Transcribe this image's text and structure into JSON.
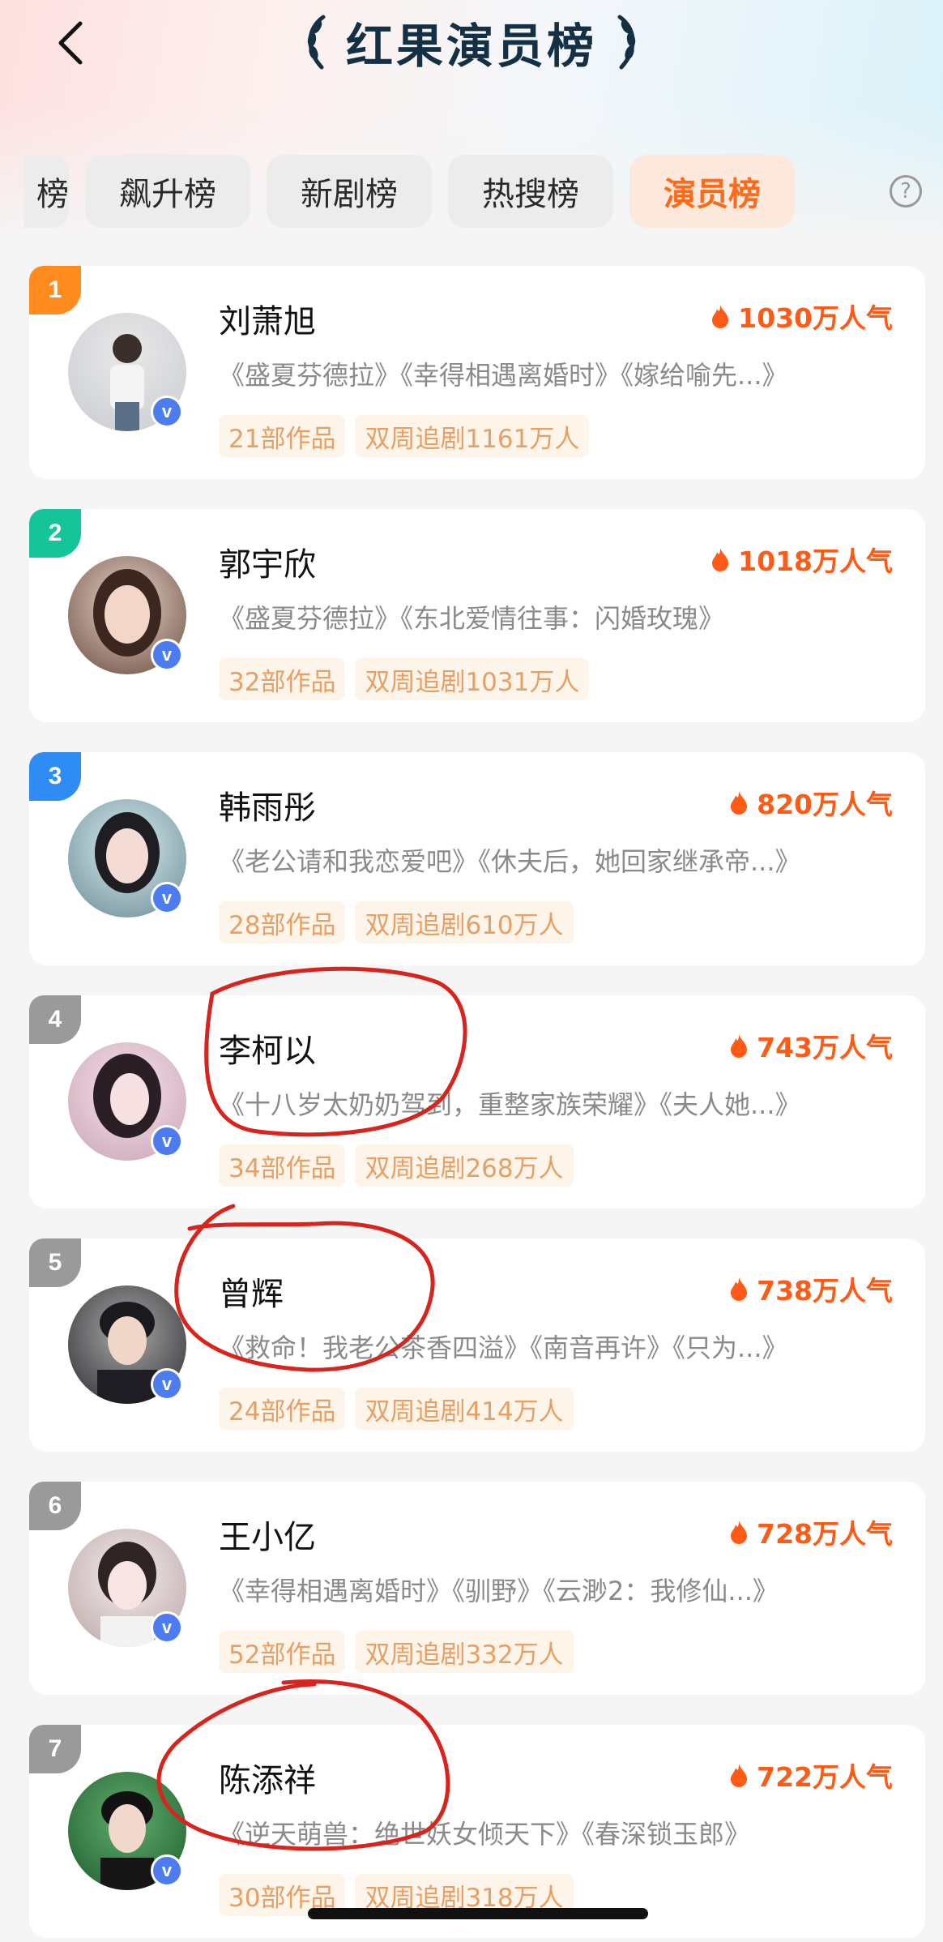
{
  "header": {
    "title": "红果演员榜"
  },
  "tabs": [
    {
      "label": "榜",
      "state": "partial"
    },
    {
      "label": "飙升榜",
      "state": "normal"
    },
    {
      "label": "新剧榜",
      "state": "normal"
    },
    {
      "label": "热搜榜",
      "state": "normal"
    },
    {
      "label": "演员榜",
      "state": "active"
    }
  ],
  "help": {
    "glyph": "?"
  },
  "colors": {
    "accent": "#ff6a1a",
    "rank1": "#ff8a1e",
    "rank2": "#16c49a",
    "rank3": "#2f8cf5",
    "rankOther": "#9a9a9a",
    "annotation": "#d8241c"
  },
  "actors": [
    {
      "rank": "1",
      "name": "刘萧旭",
      "heat": "1030万人气",
      "works": "《盛夏芬德拉》《幸得相遇离婚时》《嫁给喻先...》",
      "count": "21部作品",
      "follow": "双周追剧1161万人",
      "verified": "v"
    },
    {
      "rank": "2",
      "name": "郭宇欣",
      "heat": "1018万人气",
      "works": "《盛夏芬德拉》《东北爱情往事：闪婚玫瑰》",
      "count": "32部作品",
      "follow": "双周追剧1031万人",
      "verified": "v"
    },
    {
      "rank": "3",
      "name": "韩雨彤",
      "heat": "820万人气",
      "works": "《老公请和我恋爱吧》《休夫后，她回家继承帝...》",
      "count": "28部作品",
      "follow": "双周追剧610万人",
      "verified": "v"
    },
    {
      "rank": "4",
      "name": "李柯以",
      "heat": "743万人气",
      "works": "《十八岁太奶奶驾到，重整家族荣耀》《夫人她...》",
      "count": "34部作品",
      "follow": "双周追剧268万人",
      "verified": "v"
    },
    {
      "rank": "5",
      "name": "曾辉",
      "heat": "738万人气",
      "works": "《救命！我老公茶香四溢》《南音再许》《只为...》",
      "count": "24部作品",
      "follow": "双周追剧414万人",
      "verified": "v"
    },
    {
      "rank": "6",
      "name": "王小亿",
      "heat": "728万人气",
      "works": "《幸得相遇离婚时》《驯野》《云渺2：我修仙...》",
      "count": "52部作品",
      "follow": "双周追剧332万人",
      "verified": "v"
    },
    {
      "rank": "7",
      "name": "陈添祥",
      "heat": "722万人气",
      "works": "《逆天萌兽：绝世妖女倾天下》《春深锁玉郎》",
      "count": "30部作品",
      "follow": "双周追剧318万人",
      "verified": "v"
    }
  ]
}
